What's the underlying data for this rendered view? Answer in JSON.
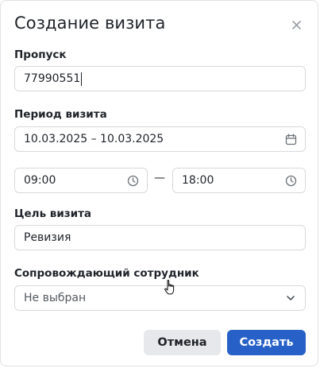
{
  "dialog": {
    "title": "Создание визита",
    "close_icon": "close-icon"
  },
  "pass": {
    "label": "Пропуск",
    "value": "77990551"
  },
  "period": {
    "label": "Период визита",
    "date_range": "10.03.2025 – 10.03.2025",
    "calendar_icon": "calendar-icon",
    "time_from": "09:00",
    "time_to": "18:00",
    "separator": "—",
    "clock_icon": "clock-icon"
  },
  "purpose": {
    "label": "Цель визита",
    "value": "Ревизия"
  },
  "escort": {
    "label": "Сопровождающий сотрудник",
    "selected": "Не выбран",
    "chevron_icon": "chevron-down-icon"
  },
  "actions": {
    "cancel_label": "Отмена",
    "create_label": "Создать"
  },
  "colors": {
    "primary": "#2761c8",
    "secondary_button": "#e6e8eb",
    "border": "#d6d9dd"
  }
}
